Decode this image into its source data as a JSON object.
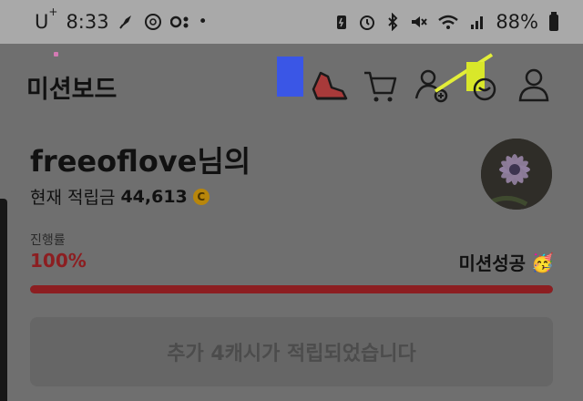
{
  "status_bar": {
    "carrier": "U",
    "carrier_sup": "+",
    "time": "8:33",
    "battery": "88%"
  },
  "header": {
    "title": "미션보드",
    "icons": [
      "shoe-icon",
      "cart-icon",
      "add-friend-icon",
      "support-icon",
      "profile-icon"
    ]
  },
  "profile": {
    "name": "freeoflove",
    "name_suffix": "님의",
    "points_label": "현재 적립금",
    "points_value": "44,613",
    "coin_symbol": "C"
  },
  "progress": {
    "label": "진행률",
    "value_text": "100%",
    "value": 1.0,
    "status": "미션성공",
    "status_emoji": "🥳"
  },
  "cta": {
    "label": "추가 4캐시가 적립되었습니다"
  },
  "colors": {
    "accent": "#8c1e21",
    "overlay": "#6f6f6f",
    "statusbar": "#a9a9a9"
  }
}
